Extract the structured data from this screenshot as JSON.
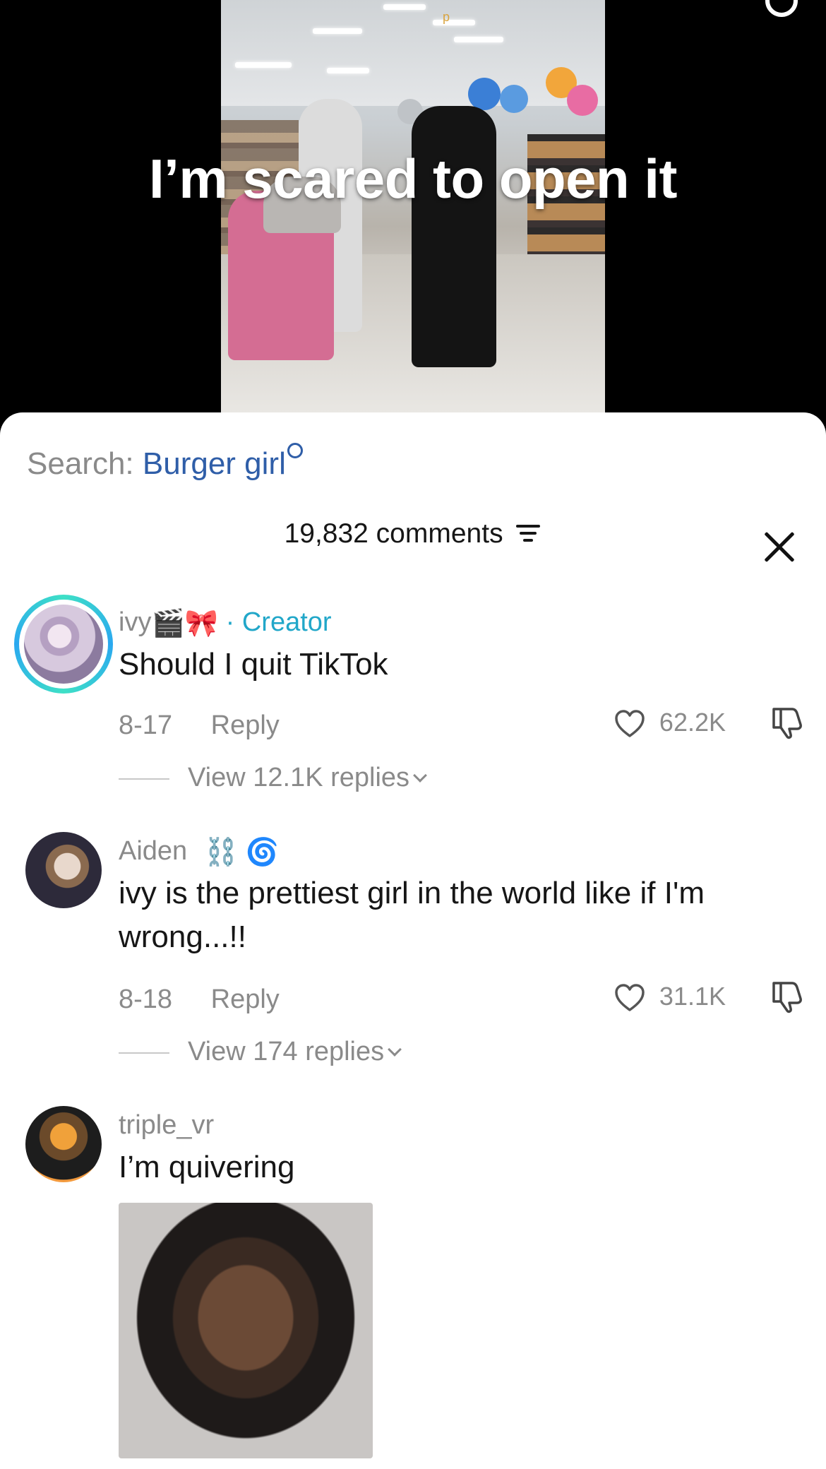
{
  "video": {
    "caption": "I’m scared to open it",
    "corner_text": "p"
  },
  "search": {
    "prefix": "Search:",
    "term": "Burger girl"
  },
  "comments_header": {
    "count_label": "19,832 comments"
  },
  "comments": [
    {
      "username": "ivy",
      "username_emojis": "🎬🎀",
      "creator_label": "· Creator",
      "text": "Should I quit TikTok",
      "date": "8-17",
      "reply_label": "Reply",
      "likes": "62.2K",
      "view_replies": "View 12.1K replies"
    },
    {
      "username": "Aiden",
      "username_emojis": "⛓️ 🌀",
      "text": "ivy is the prettiest girl in the world like if I'm wrong...!!",
      "date": "8-18",
      "reply_label": "Reply",
      "likes": "31.1K",
      "view_replies": "View 174 replies"
    },
    {
      "username": "triple_vr",
      "text": "I’m quivering"
    }
  ],
  "colors": {
    "accent_link": "#2f5ea8",
    "creator": "#21a7c9",
    "muted": "#8a8a8a",
    "text": "#161616"
  }
}
